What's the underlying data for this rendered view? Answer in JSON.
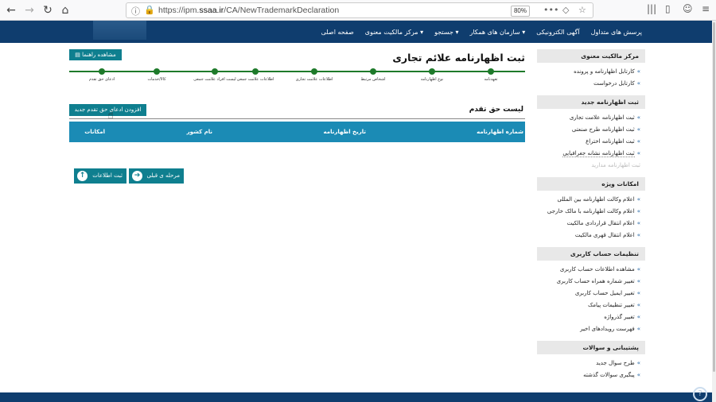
{
  "browser": {
    "url_prefix": "https://ipm.",
    "url_domain": "ssaa.ir",
    "url_path": "/CA/NewTrademarkDeclaration",
    "zoom": "80%"
  },
  "topnav": {
    "items": [
      "صفحه اصلی",
      "مرکز مالکیت معنوی",
      "جستجو",
      "سازمان های همکار",
      "آگهی الکترونیکی",
      "پرسش های متداول"
    ]
  },
  "sidebar": {
    "sections": [
      {
        "title": "مرکز مالکیت معنوی",
        "items": [
          "کارتابل اظهارنامه و پرونده",
          "کارتابل درخواست"
        ]
      },
      {
        "title": "ثبت اظهارنامه جدید",
        "items": [
          "ثبت اظهارنامه علامت تجاری",
          "ثبت اظهارنامه طرح صنعتی",
          "ثبت اظهارنامه اختراع",
          "ثبت اظهارنامه نشانه جغرافیایی"
        ],
        "dim_item": "ثبت اظهارنامه مدارید"
      },
      {
        "title": "امکانات ویژه",
        "items": [
          "اعلام وکالت اظهارنامه بین المللی",
          "اعلام وکالت اظهارنامه با مالک خارجی",
          "اعلام انتقال قراردادی مالکیت",
          "اعلام انتقال قهری مالکیت"
        ]
      },
      {
        "title": "تنظیمات حساب کاربری",
        "items": [
          "مشاهده اطلاعات حساب کاربری",
          "تغییر شماره همراه حساب کاربری",
          "تغییر ایمیل حساب کاربری",
          "تغییر تنظیمات پیامک",
          "تغییر گذرواژه",
          "فهرست رویدادهای اخیر"
        ]
      },
      {
        "title": "پشتیبانی و سوالات",
        "items": [
          "طرح سوال جدید",
          "پیگیری سوالات گذشته"
        ]
      }
    ]
  },
  "main": {
    "page_title": "ثبت اظهارنامه علائم تجاری",
    "guide_button": "مشاهده راهنما",
    "steps": [
      "تعهدنامه",
      "نوع اظهارنامه",
      "اشخاص مرتبط",
      "اطلاعات علامت تجاری",
      "اطلاعات علامت جمعی",
      "لیست افراد علامت جمعی",
      "کالا/خدمات",
      "ادعای حق تقدم"
    ],
    "list_title": "لیست حق تقدم",
    "add_button": "افزودن ادعای حق تقدم جدید",
    "table_headers": [
      "شماره اظهارنامه",
      "تاریخ اظهارنامه",
      "نام کشور",
      "امکانات"
    ],
    "prev_button": "مرحله ی قبلی",
    "submit_button": "ثبت اطلاعات"
  }
}
